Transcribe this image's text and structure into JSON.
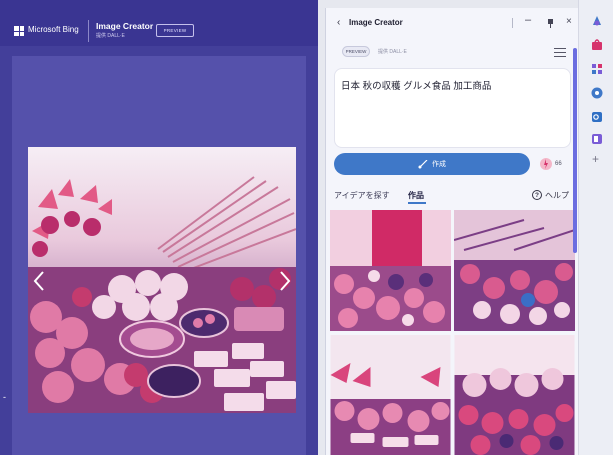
{
  "main_page": {
    "brand": "Microsoft Bing",
    "product_title": "Image Creator",
    "product_subtitle": "提供 DALL·E",
    "preview_badge": "PREVIEW",
    "nav_prev_icon": "chevron-left-icon",
    "nav_next_icon": "chevron-right-icon",
    "edge_mark": "-"
  },
  "sidebar_panel": {
    "title": "Image Creator",
    "back_icon": "chevron-left-icon",
    "minimize_icon": "minus-icon",
    "pin_icon": "pin-icon",
    "close_icon": "close-icon",
    "chip_preview": "PREVIEW",
    "chip_dalle": "提供 DALL·E",
    "menu_icon": "hamburger-icon",
    "prompt": "日本  秋の収穫  グルメ食品  加工商品",
    "create_label": "作成",
    "create_icon": "brush-icon",
    "boost_icon": "boost-icon",
    "boost_count": "66",
    "tabs": [
      "アイデアを探す",
      "作品"
    ],
    "help_label": "ヘルプ",
    "help_icon": "question-icon"
  },
  "edge_sidebar": {
    "icons": [
      "copilot-icon",
      "shopping-icon",
      "tools-icon",
      "games-icon",
      "outlook-icon",
      "office-icon"
    ],
    "add_label": "+"
  },
  "colors": {
    "page_bg": "#433f9a",
    "accent_blue": "#3f78c8",
    "panel_bg": "#f4f5fb",
    "scroll_thumb": "#6b6de0"
  }
}
